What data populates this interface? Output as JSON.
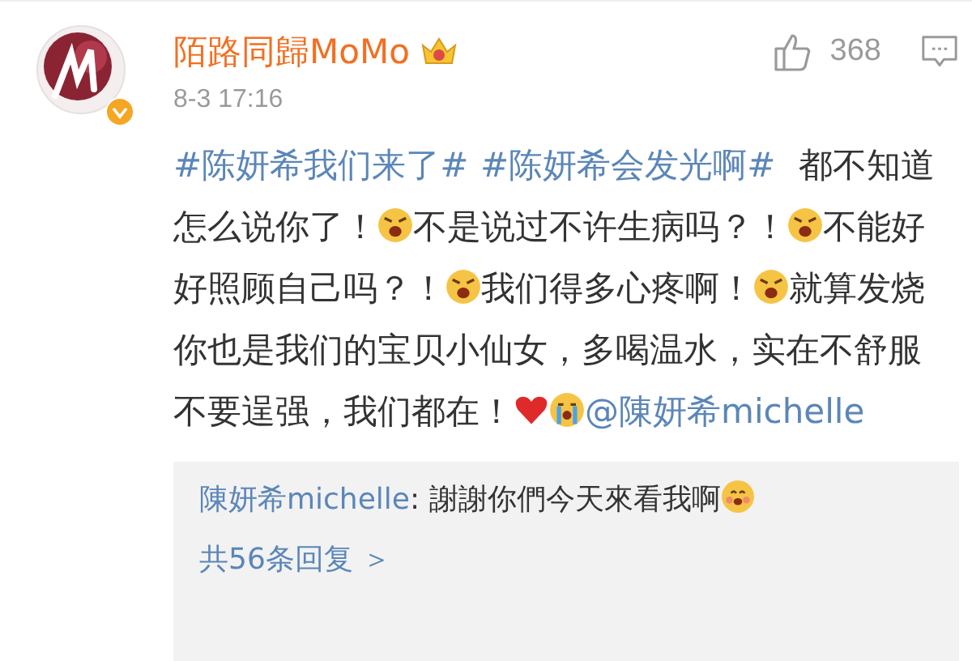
{
  "comment": {
    "username": "陌路同歸MoMo",
    "verified": true,
    "likes": "368",
    "time": "8-3 17:16",
    "body": [
      {
        "kind": "hashtag",
        "text": "#陈妍希我们来了#"
      },
      {
        "kind": "hashtag",
        "text": "#陈妍希会发光啊#"
      },
      {
        "kind": "text",
        "text": " 都不知道怎么说你了！"
      },
      {
        "kind": "emoji"
      },
      {
        "kind": "text",
        "text": "不是说过不许生病吗？！"
      },
      {
        "kind": "emoji"
      },
      {
        "kind": "text",
        "text": "不能好好照顾自己吗？！"
      },
      {
        "kind": "emoji"
      },
      {
        "kind": "text",
        "text": "我们得多心疼啊！"
      },
      {
        "kind": "emoji"
      },
      {
        "kind": "text",
        "text": "就算发烧你也是我们的宝贝小仙女，多喝温水，实在不舒服不要逞强，我们都在！"
      },
      {
        "kind": "heart"
      },
      {
        "kind": "crying"
      },
      {
        "kind": "mention",
        "text": "@陳妍希michelle"
      }
    ]
  },
  "reply": {
    "author": "陳妍希michelle",
    "text": ": 謝謝你們今天來看我啊",
    "more": "共56条回复 ＞"
  }
}
